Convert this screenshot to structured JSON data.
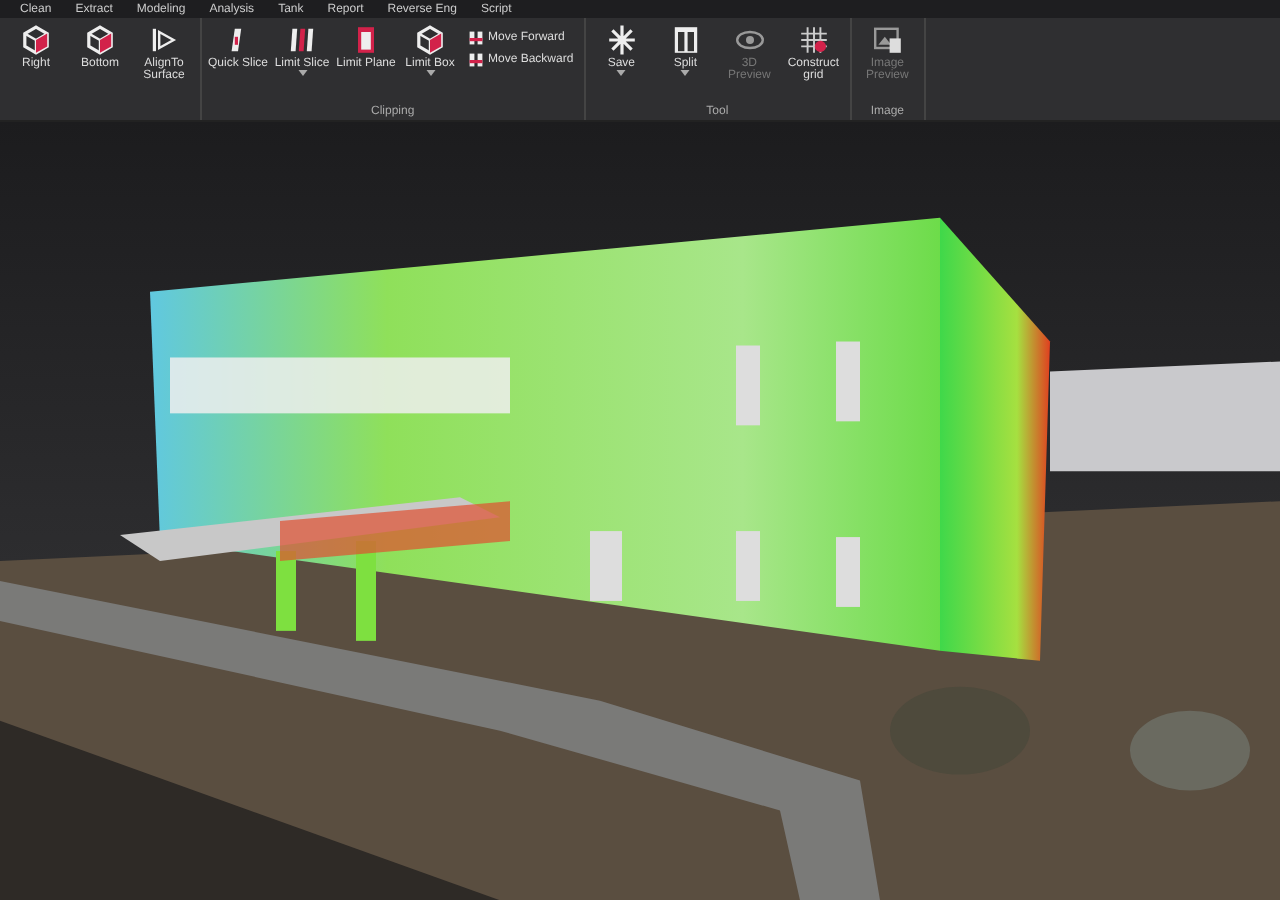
{
  "menu": [
    "Clean",
    "Extract",
    "Modeling",
    "Analysis",
    "Tank",
    "Report",
    "Reverse Eng",
    "Script"
  ],
  "ribbon": {
    "groups": [
      {
        "items": [
          {
            "label": "Right",
            "kind": "large",
            "dropdown": false,
            "disabled": false
          },
          {
            "label": "Bottom",
            "kind": "large",
            "dropdown": false,
            "disabled": false
          },
          {
            "label": "AlignTo Surface",
            "kind": "large",
            "dropdown": false,
            "disabled": false
          }
        ]
      },
      {
        "label": "Clipping",
        "items": [
          {
            "label": "Quick Slice",
            "kind": "large",
            "dropdown": false,
            "disabled": false
          },
          {
            "label": "Limit Slice",
            "kind": "large",
            "dropdown": true,
            "disabled": false
          },
          {
            "label": "Limit Plane",
            "kind": "large",
            "dropdown": false,
            "disabled": false
          },
          {
            "label": "Limit Box",
            "kind": "large",
            "dropdown": true,
            "disabled": false
          },
          {
            "label": "Move Forward",
            "kind": "small",
            "disabled": false
          },
          {
            "label": "Move Backward",
            "kind": "small",
            "disabled": false
          }
        ]
      },
      {
        "label": "Tool",
        "items": [
          {
            "label": "Save",
            "kind": "large",
            "dropdown": true,
            "disabled": false
          },
          {
            "label": "Split",
            "kind": "large",
            "dropdown": true,
            "disabled": false
          },
          {
            "label": "3D Preview",
            "kind": "large",
            "dropdown": false,
            "disabled": true
          },
          {
            "label": "Construct grid",
            "kind": "large",
            "dropdown": false,
            "disabled": false
          }
        ]
      },
      {
        "label": "Image",
        "items": [
          {
            "label": "Image Preview",
            "kind": "large",
            "dropdown": false,
            "disabled": true
          }
        ]
      }
    ]
  }
}
